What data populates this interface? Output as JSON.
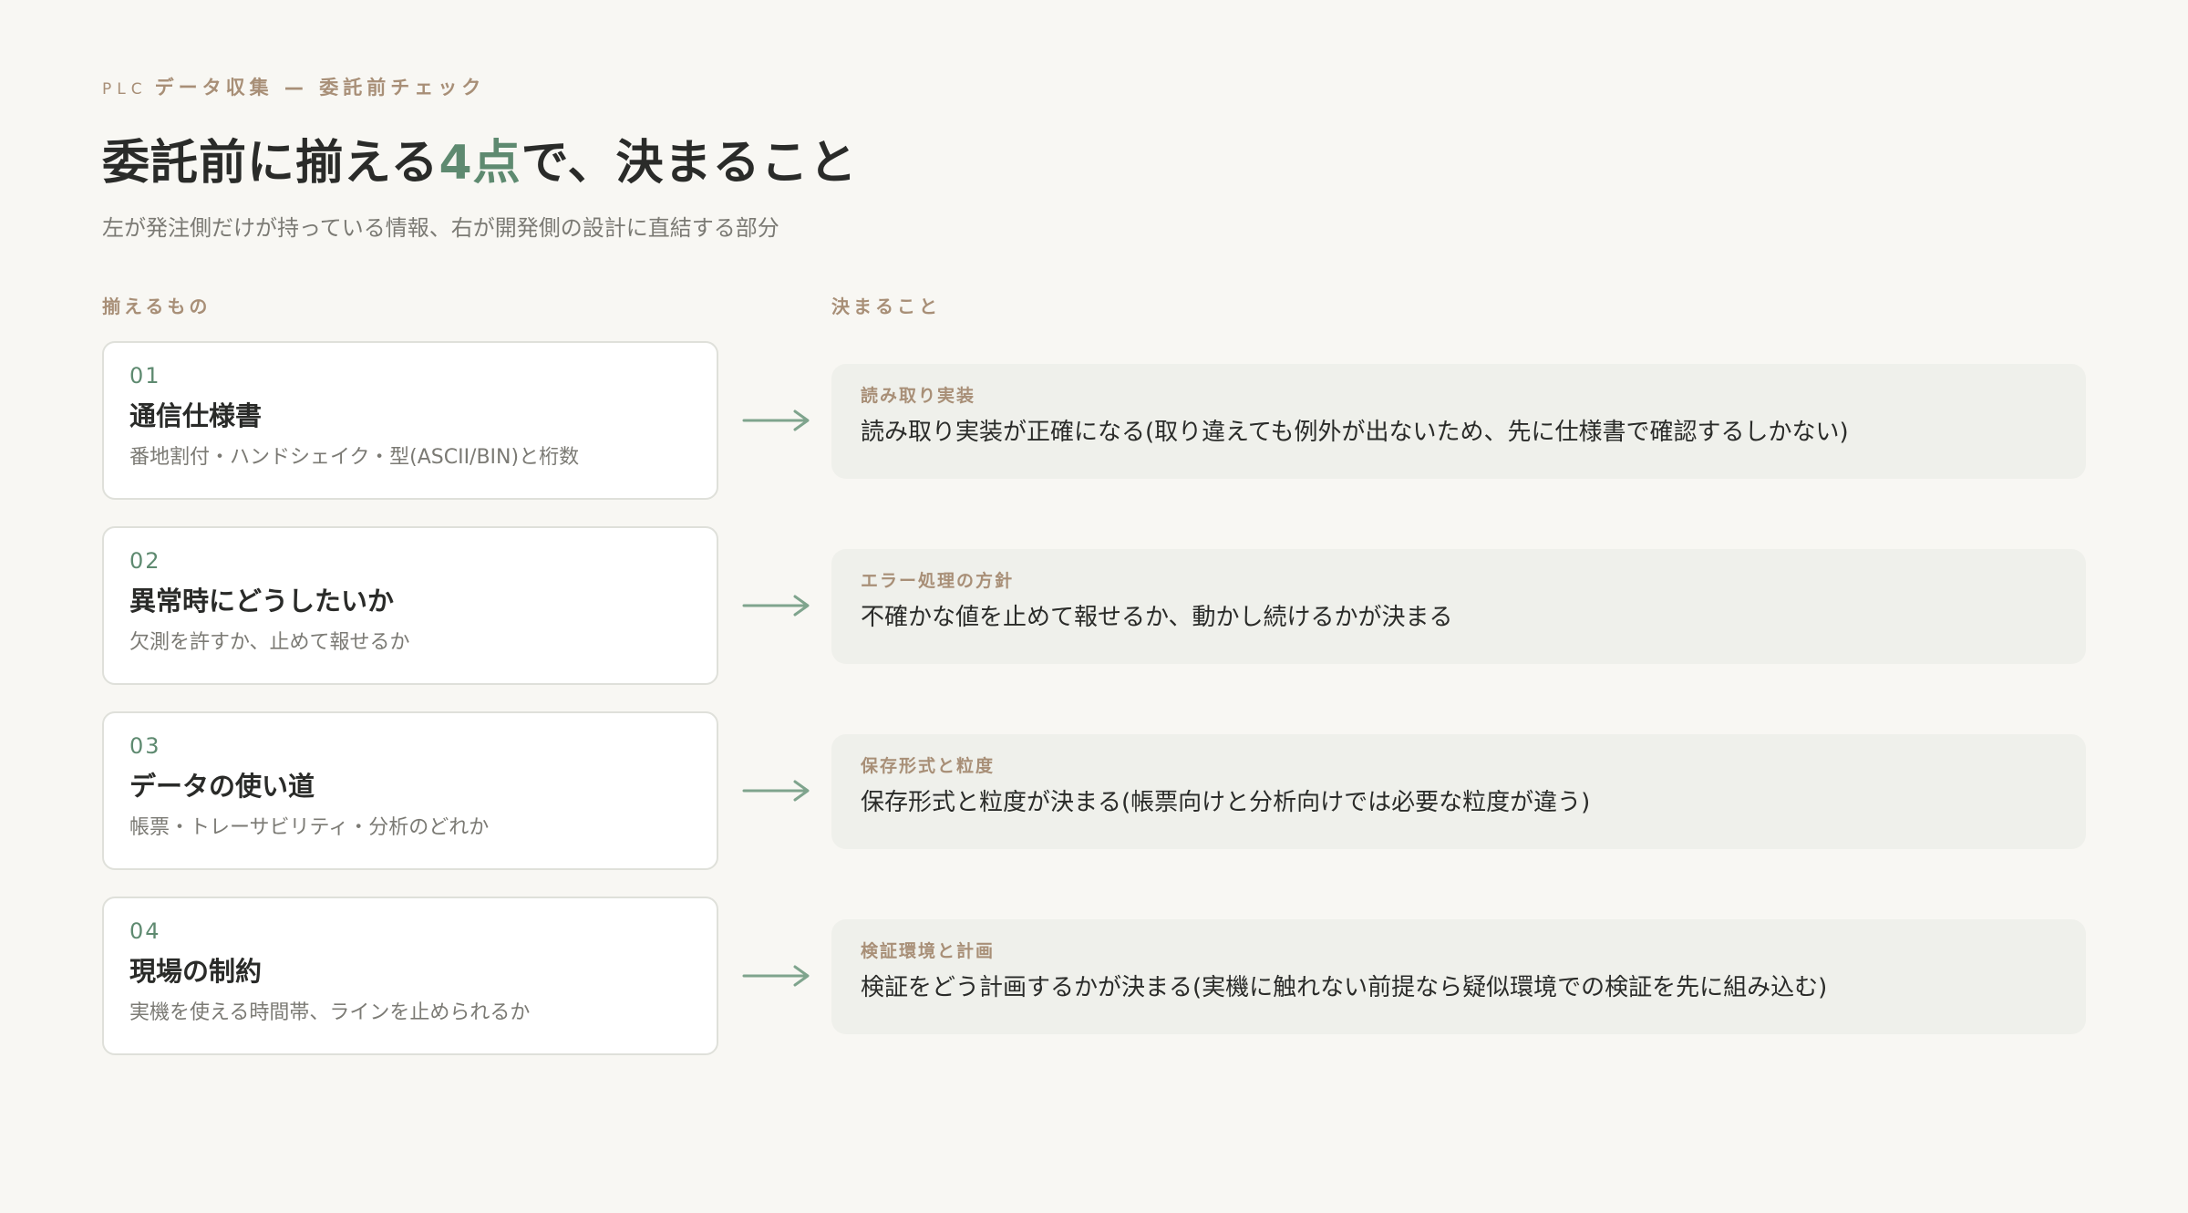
{
  "header": {
    "eyebrow_prefix": "PLC",
    "eyebrow_text": "データ収集 — 委託前チェック",
    "title_part1": "委託前に揃える",
    "title_accent": "4点",
    "title_part2": "で、決まること",
    "subtitle": "左が発注側だけが持っている情報、右が開発側の設計に直結する部分"
  },
  "columns": {
    "left_label": "揃えるもの",
    "right_label": "決まること"
  },
  "colors": {
    "accent_green": "#5e8a70",
    "label_brown": "#a88f77",
    "background": "#f8f7f3",
    "result_bg": "#eff0eb"
  },
  "rows": [
    {
      "num": "01",
      "name": "通信仕様書",
      "desc": "番地割付・ハンドシェイク・型(ASCII/BIN)と桁数",
      "result_label": "読み取り実装",
      "result_text": "読み取り実装が正確になる(取り違えても例外が出ないため、先に仕様書で確認するしかない)"
    },
    {
      "num": "02",
      "name": "異常時にどうしたいか",
      "desc": "欠測を許すか、止めて報せるか",
      "result_label": "エラー処理の方針",
      "result_text": "不確かな値を止めて報せるか、動かし続けるかが決まる"
    },
    {
      "num": "03",
      "name": "データの使い道",
      "desc": "帳票・トレーサビリティ・分析のどれか",
      "result_label": "保存形式と粒度",
      "result_text": "保存形式と粒度が決まる(帳票向けと分析向けでは必要な粒度が違う)"
    },
    {
      "num": "04",
      "name": "現場の制約",
      "desc": "実機を使える時間帯、ラインを止められるか",
      "result_label": "検証環境と計画",
      "result_text": "検証をどう計画するかが決まる(実機に触れない前提なら疑似環境での検証を先に組み込む)"
    }
  ]
}
